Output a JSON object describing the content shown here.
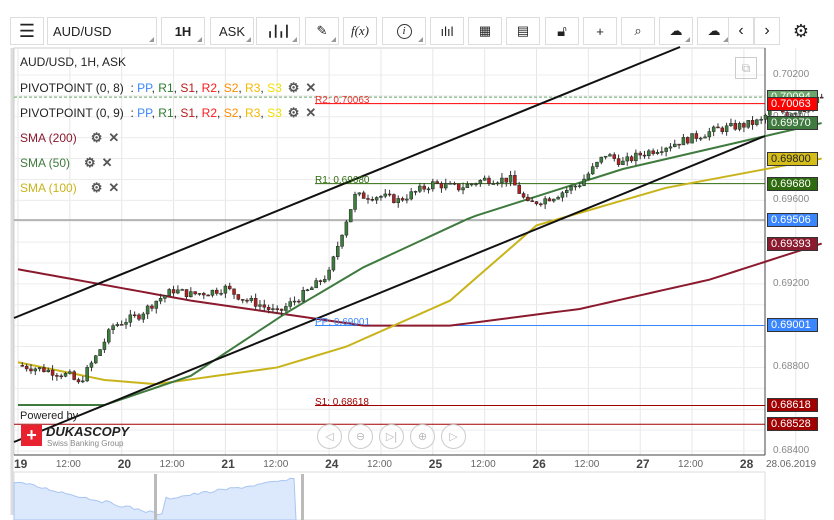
{
  "toolbar": {
    "menu_icon": "hamburger-icon",
    "instrument": "AUD/USD",
    "timeframe": "1H",
    "side": "ASK",
    "buttons": [
      "candlestick-icon",
      "pencil-icon",
      "function-icon",
      "info-icon",
      "volume-bars-icon",
      "calendar-icon",
      "news-icon",
      "lock-icon",
      "crosshair-icon",
      "zoom-analysis-icon",
      "cloud-upload-icon",
      "cloud-download-icon",
      "chevron-left-icon",
      "chevron-right-icon",
      "gear-icon"
    ],
    "fx_label": "f(x)"
  },
  "legend": {
    "title": "AUD/USD, 1H, ASK",
    "pivots": [
      {
        "name": "PIVOTPOINT (0, 8)"
      },
      {
        "name": "PIVOTPOINT (0, 9)"
      }
    ],
    "pivot_parts": [
      {
        "t": "PP",
        "c": "#3a86ff"
      },
      {
        "t": "R1",
        "c": "#2e7d32"
      },
      {
        "t": "S1",
        "c": "#b71c1c"
      },
      {
        "t": "R2",
        "c": "#ff1a1a"
      },
      {
        "t": "S2",
        "c": "#ff8c00"
      },
      {
        "t": "R3",
        "c": "#f5b800"
      },
      {
        "t": "S3",
        "c": "#f0e000"
      }
    ],
    "sma": [
      {
        "name": "SMA (200)",
        "color": "#8b1a2e"
      },
      {
        "name": "SMA (50)",
        "color": "#3f7a3f"
      },
      {
        "name": "SMA (100)",
        "color": "#c8b41a"
      }
    ]
  },
  "levels": {
    "r2": "R2: 0.70063",
    "r1": "R1: 0.69680",
    "pp": "PP: 0.69001",
    "s1": "S1: 0.68618"
  },
  "price_labels": [
    {
      "v": "0.70094",
      "c": "#6aa66a",
      "p": 0.70094
    },
    {
      "v": "0.70063",
      "c": "#ff0000",
      "p": 0.70063
    },
    {
      "v": "0.69970",
      "c": "#3f7a3f",
      "p": 0.6997
    },
    {
      "v": "0.69800",
      "c": "#d4bc1a",
      "p": 0.698,
      "dark": true
    },
    {
      "v": "0.69680",
      "c": "#2e6b0e",
      "p": 0.6968
    },
    {
      "v": "0.69506",
      "c": "#3a86ff",
      "p": 0.69506
    },
    {
      "v": "0.69393",
      "c": "#8b1a2e",
      "p": 0.69393
    },
    {
      "v": "0.69001",
      "c": "#3a86ff",
      "p": 0.69001
    },
    {
      "v": "0.68618",
      "c": "#a00000",
      "p": 0.68618
    },
    {
      "v": "0.68528",
      "c": "#a00000",
      "p": 0.68528
    }
  ],
  "y_ticks": [
    "0.70200",
    "0.70000",
    "0.69600",
    "0.69200",
    "0.68800",
    "0.68400"
  ],
  "x_labels": [
    {
      "t": "19",
      "b": true
    },
    {
      "t": "12:00"
    },
    {
      "t": "20",
      "b": true
    },
    {
      "t": "12:00"
    },
    {
      "t": "21",
      "b": true
    },
    {
      "t": "12:00"
    },
    {
      "t": "24",
      "b": true
    },
    {
      "t": "12:00"
    },
    {
      "t": "25",
      "b": true
    },
    {
      "t": "12:00"
    },
    {
      "t": "26",
      "b": true
    },
    {
      "t": "12:00"
    },
    {
      "t": "27",
      "b": true
    },
    {
      "t": "12:00"
    },
    {
      "t": "28",
      "b": true
    }
  ],
  "date_label": "28.06.2019",
  "branding": {
    "powered": "Powered by",
    "brand": "DUKASCOPY",
    "sub": "Swiss Banking Group"
  },
  "chart_data": {
    "type": "candlestick",
    "ylim": [
      0.684,
      0.7022
    ],
    "closes_keypoints": [
      [
        0,
        0.6881
      ],
      [
        6,
        0.6879
      ],
      [
        12,
        0.6876
      ],
      [
        14,
        0.6872
      ],
      [
        18,
        0.6885
      ],
      [
        22,
        0.69
      ],
      [
        28,
        0.6905
      ],
      [
        32,
        0.6912
      ],
      [
        36,
        0.6917
      ],
      [
        40,
        0.6915
      ],
      [
        44,
        0.6916
      ],
      [
        48,
        0.6918
      ],
      [
        52,
        0.6913
      ],
      [
        56,
        0.691
      ],
      [
        60,
        0.6906
      ],
      [
        64,
        0.6912
      ],
      [
        68,
        0.6918
      ],
      [
        72,
        0.6925
      ],
      [
        75,
        0.6945
      ],
      [
        78,
        0.6962
      ],
      [
        84,
        0.6962
      ],
      [
        88,
        0.696
      ],
      [
        96,
        0.6968
      ],
      [
        102,
        0.6966
      ],
      [
        108,
        0.697
      ],
      [
        114,
        0.697
      ],
      [
        118,
        0.6958
      ],
      [
        124,
        0.6962
      ],
      [
        130,
        0.6968
      ],
      [
        136,
        0.6982
      ],
      [
        140,
        0.6978
      ],
      [
        144,
        0.6982
      ],
      [
        150,
        0.6986
      ],
      [
        156,
        0.699
      ],
      [
        162,
        0.6994
      ],
      [
        168,
        0.6996
      ],
      [
        172,
        0.6998
      ],
      [
        174,
        0.7003
      ],
      [
        178,
        0.7002
      ],
      [
        182,
        0.7004
      ],
      [
        186,
        0.70094
      ]
    ],
    "sma200": [
      [
        0,
        0.6927
      ],
      [
        40,
        0.6912
      ],
      [
        60,
        0.6906
      ],
      [
        80,
        0.69
      ],
      [
        100,
        0.69
      ],
      [
        130,
        0.6908
      ],
      [
        160,
        0.6922
      ],
      [
        186,
        0.69393
      ]
    ],
    "sma50": [
      [
        0,
        0.6862
      ],
      [
        20,
        0.6862
      ],
      [
        40,
        0.6876
      ],
      [
        62,
        0.6906
      ],
      [
        80,
        0.6928
      ],
      [
        105,
        0.6952
      ],
      [
        140,
        0.6975
      ],
      [
        186,
        0.6997
      ]
    ],
    "sma100": [
      [
        0,
        0.68825
      ],
      [
        20,
        0.6874
      ],
      [
        32,
        0.6872
      ],
      [
        60,
        0.688
      ],
      [
        76,
        0.689
      ],
      [
        100,
        0.6912
      ],
      [
        120,
        0.6948
      ],
      [
        150,
        0.6966
      ],
      [
        186,
        0.698
      ]
    ]
  }
}
